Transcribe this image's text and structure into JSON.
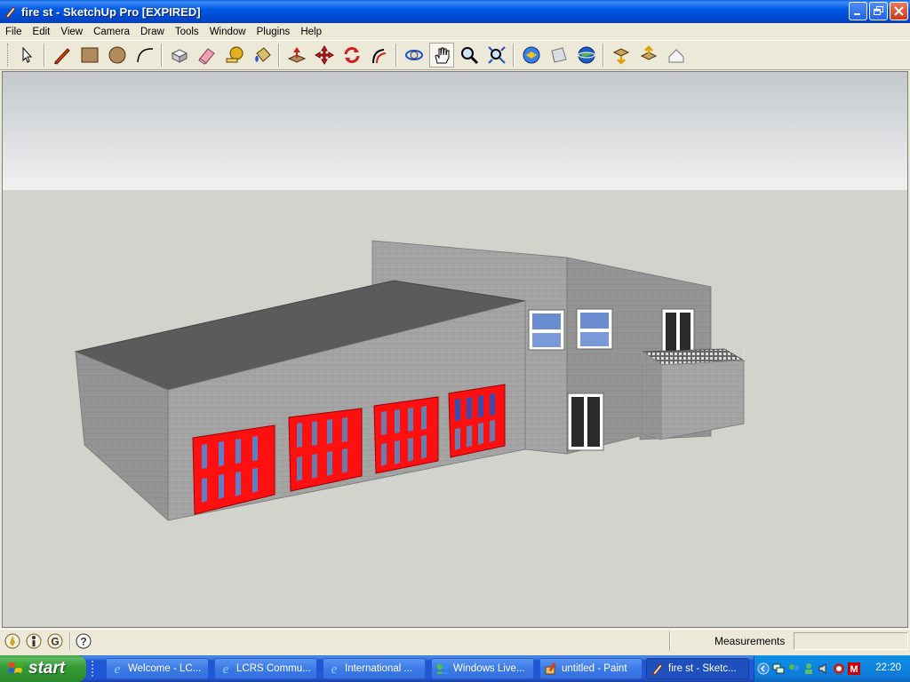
{
  "window": {
    "title": "fire st - SketchUp Pro [EXPIRED]",
    "controls": {
      "minimize": "minimize-icon",
      "restore": "restore-icon",
      "close": "close-icon"
    }
  },
  "menu": [
    "File",
    "Edit",
    "View",
    "Camera",
    "Draw",
    "Tools",
    "Window",
    "Plugins",
    "Help"
  ],
  "toolbar": {
    "tools": [
      "select-tool-icon",
      "pencil-tool-icon",
      "rectangle-tool-icon",
      "circle-tool-icon",
      "arc-tool-icon",
      "make-component-icon",
      "eraser-tool-icon",
      "tape-measure-icon",
      "paint-bucket-icon",
      "push-pull-icon",
      "move-tool-icon",
      "rotate-tool-icon",
      "follow-me-icon",
      "orbit-icon",
      "pan-icon",
      "zoom-icon",
      "zoom-extents-icon",
      "get-models-icon",
      "share-model-icon",
      "google-earth-icon",
      "get-photo-texture-icon",
      "place-model-icon",
      "toggle-terrain-icon"
    ],
    "active_tool": "pan-icon"
  },
  "statusbar": {
    "measurements_label": "Measurements",
    "measurements_value": ""
  },
  "taskbar": {
    "start_label": "start",
    "tasks": [
      {
        "label": "Welcome - LC...",
        "icon": "internet-explorer-icon",
        "active": false
      },
      {
        "label": "LCRS Commu...",
        "icon": "internet-explorer-icon",
        "active": false
      },
      {
        "label": "International ...",
        "icon": "internet-explorer-icon",
        "active": false
      },
      {
        "label": "Windows Live...",
        "icon": "windows-live-icon",
        "active": false
      },
      {
        "label": "untitled - Paint",
        "icon": "paint-icon",
        "active": false
      },
      {
        "label": "fire st - Sketc...",
        "icon": "sketchup-icon",
        "active": true
      }
    ],
    "clock": "22:20"
  },
  "colors": {
    "xp_blue": "#0058e6",
    "door_red": "#ff1010",
    "sky_top": "#c3c8cb",
    "ground": "#d3d3cd",
    "wall": "#9b9b9b",
    "roof": "#5b5b5b"
  }
}
